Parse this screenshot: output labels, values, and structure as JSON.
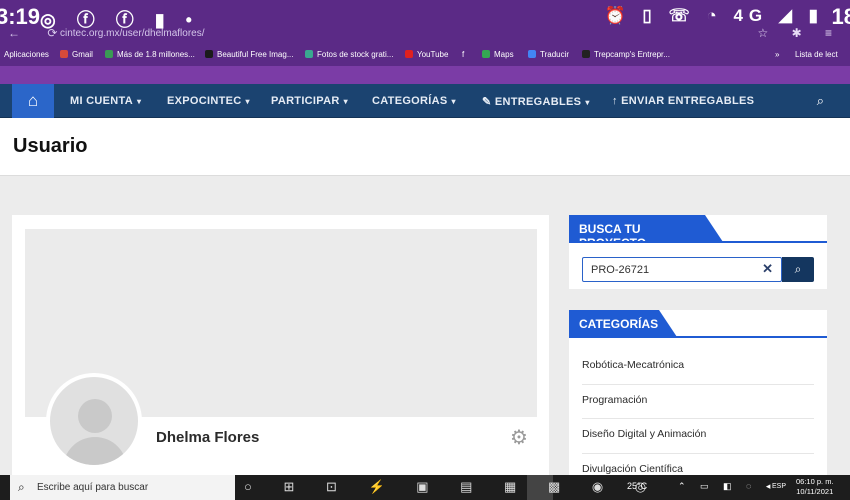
{
  "status_bar": {
    "time": "3:19",
    "time_right": "18",
    "left_icons": "◎ ⓕ ⓕ ▮ •",
    "right_icons": "⏰ ▯ ☏ ◔ 4G ◢ ▮"
  },
  "browser": {
    "tab_ghost": "—",
    "url": "cintec.org.mx/user/dhelmaflores/",
    "nav_icons": "← ⟳",
    "right_icons": "☆ ✱ ≡"
  },
  "bookmarks": {
    "items": [
      {
        "label": "Aplicaciones",
        "color": "#6b6b6b"
      },
      {
        "label": "Gmail",
        "color": "#d64a3a"
      },
      {
        "label": "Más de 1.8 millones...",
        "color": "#3a9a54"
      },
      {
        "label": "Beautiful Free Imag...",
        "color": "#1b1b1b"
      },
      {
        "label": "Fotos de stock grati...",
        "color": "#3aa890"
      },
      {
        "label": "YouTube",
        "color": "#e02020"
      },
      {
        "label": "f",
        "color": "#3b5998"
      },
      {
        "label": "Maps",
        "color": "#34a853"
      },
      {
        "label": "Traducir",
        "color": "#4285f4"
      },
      {
        "label": "Trepcamp's Entrepr...",
        "color": "#222222"
      },
      {
        "label": "»",
        "color": ""
      },
      {
        "label": "Lista de lect",
        "color": "#cccccc"
      }
    ]
  },
  "navbar": {
    "home_icon": "⌂",
    "items": [
      {
        "label": "MI CUENTA",
        "caret": "▾"
      },
      {
        "label": "EXPOCINTEC",
        "caret": "▾"
      },
      {
        "label": "PARTICIPAR",
        "caret": "▾"
      },
      {
        "label": "CATEGORÍAS",
        "caret": "▾"
      },
      {
        "label": "ENTREGABLES",
        "caret": "▾",
        "icon": "✎"
      },
      {
        "label": "ENVIAR ENTREGABLES",
        "caret": "",
        "icon": "↑"
      }
    ],
    "search_icon": "⌕"
  },
  "page": {
    "title": "Usuario"
  },
  "profile": {
    "name": "Dhelma Flores",
    "settings_icon": "⚙"
  },
  "search_widget": {
    "title": "BUSCA TU PROYECTO",
    "value": "PRO-26721",
    "clear_icon": "✕",
    "search_icon": "⌕"
  },
  "categories_widget": {
    "title": "CATEGORÍAS",
    "items": [
      "Robótica-Mecatrónica",
      "Programación",
      "Diseño Digital y Animación",
      "Divulgación Científica"
    ]
  },
  "taskbar": {
    "search_icon": "⌕",
    "search_placeholder": "Escribe aquí para buscar",
    "apps": "○ ⊞ ⊡ ⚡ ▣ ▤ ▦ ▩ ◉ ◎",
    "weather": "25°C",
    "tray": "⌃ ▭ ◧ ◌ ◂",
    "lang": "ESP",
    "time": "06:10 p. m.",
    "date": "10/11/2021"
  }
}
